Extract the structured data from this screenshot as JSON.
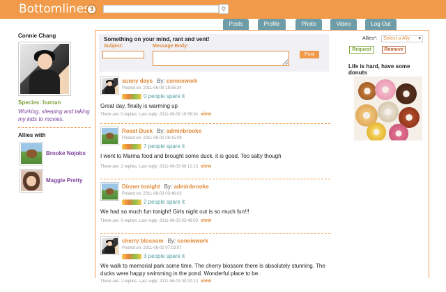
{
  "header": {
    "logo": "Bottomlines",
    "badge_count": "3",
    "search_placeholder": "",
    "search_icon": "magnifier-icon"
  },
  "nav": {
    "tabs": [
      "Posts",
      "Profile",
      "Photo",
      "Video",
      "Log Out"
    ]
  },
  "profile": {
    "name": "Connie Chang",
    "species_label": "Species:",
    "species_value": "human",
    "about": "Working, sleeping and taking my kids to movies.",
    "allies_title": "Allies with",
    "allies": [
      {
        "name": "Brooke Nojobs"
      },
      {
        "name": "Maggie Pretty"
      }
    ]
  },
  "post_form": {
    "title": "Something on your mind, rant and vent!",
    "subject_label": "Subject:",
    "body_label": "Message Body:",
    "post_button": "Post"
  },
  "feed": [
    {
      "title": "sunny days",
      "by_label": "By:",
      "author": "conniework",
      "posted": "Posted on: 2011-06-08 18:56:34",
      "spare": "0 people spare it",
      "body": "Great day, finally is warming up",
      "stats": "There are: 0 replies. Last reply: 2011-06-08 18:56:34",
      "view": "view",
      "avatar": "woman"
    },
    {
      "title": "Roast Duck",
      "by_label": "By:",
      "author": "adminbrooke",
      "posted": "Posted on: 2011-06-02 06:15:09",
      "spare": "7 people spare it",
      "body": "I went to Marina food and brought some duck, it is good. Too salty though",
      "stats": "There are: 2 replies. Last reply: 2011-06-03 06:12:13",
      "view": "view",
      "avatar": "horse"
    },
    {
      "title": "Dinner tonight",
      "by_label": "By:",
      "author": "adminbrooke",
      "posted": "Posted on: 2011-06-03 03:46:03",
      "spare": "2 people spare it",
      "body": "We had so much fun tonight! Girls night out is so much fun!!!",
      "stats": "There are: 0 replies. Last reply: 2011-06-03 03:46:03",
      "view": "view",
      "avatar": "horse"
    },
    {
      "title": "cherry blossom",
      "by_label": "By:",
      "author": "conniework",
      "posted": "Posted on: 2011-06-02 07:03:07",
      "spare": "3 people spare it",
      "body": "We walk to memorial park some time. The cherry blossom there is absolutely stunning. The ducks were happy swimming in the pond. Wonderful place to be.",
      "stats": "There are: 1 replies. Last reply: 2011-06-03 00:32:13",
      "view": "view",
      "avatar": "woman"
    }
  ],
  "right": {
    "allies_label": "Allies*:",
    "ally_select": "Select a Ally",
    "request_button": "Request",
    "remove_button": "Remove",
    "donut_title": "Life is hard, have some donuts"
  },
  "colors": {
    "accent": "#f09a4a",
    "tab": "#6f9da7",
    "link_purple": "#7c3f9a",
    "green": "#7ea23a"
  }
}
